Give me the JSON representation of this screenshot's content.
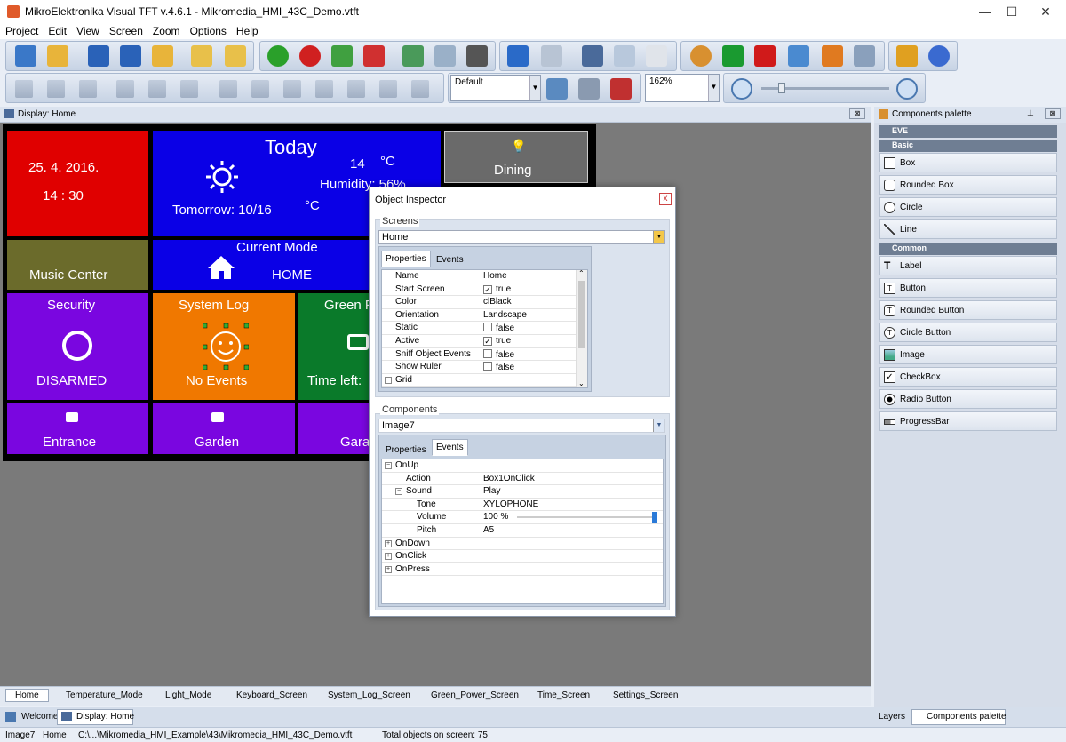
{
  "window": {
    "title": "MikroElektronika Visual TFT v.4.6.1 - Mikromedia_HMI_43C_Demo.vtft",
    "min": "—",
    "max": "☐",
    "close": "✕"
  },
  "menu": [
    "Project",
    "Edit",
    "View",
    "Screen",
    "Zoom",
    "Options",
    "Help"
  ],
  "toolbar": {
    "style_combo": "Default",
    "zoom_combo": "162%",
    "zoom_level": 0.14
  },
  "display_panel": {
    "title": "Display: Home"
  },
  "hmi": {
    "date": "25.    4.    2016.",
    "time": "14    :    30",
    "today": "Today",
    "temp": "14",
    "deg_c": "°C",
    "humidity": "Humidity: 56%",
    "tomorrow": "Tomorrow: 10/16",
    "tomorrow_deg": "°C",
    "dining": "Dining",
    "music": "Music Center",
    "current_mode": "Current Mode",
    "home": "HOME",
    "security": "Security",
    "disarmed": "DISARMED",
    "system_log": "System Log",
    "no_events": "No Events",
    "green": "Green P",
    "time_left": "Time left:",
    "entrance": "Entrance",
    "garden": "Garden",
    "garage": "Gara"
  },
  "colors": {
    "red": "#e00000",
    "blue": "#0a00e6",
    "gray": "#6a6a6a",
    "olive": "#6b6b2b",
    "purple": "#7a06e0",
    "orange": "#f07800",
    "green": "#0a7a2a"
  },
  "screen_tabs": [
    "Home",
    "Temperature_Mode",
    "Light_Mode",
    "Keyboard_Screen",
    "System_Log_Screen",
    "Green_Power_Screen",
    "Time_Screen",
    "Settings_Screen"
  ],
  "doc_tabs": [
    "Welcome",
    "Display: Home"
  ],
  "right_tabs": [
    "Layers",
    "Components palette"
  ],
  "status": {
    "obj": "Image7",
    "screen": "Home",
    "path": "C:\\...\\Mikromedia_HMI_Example\\43\\Mikromedia_HMI_43C_Demo.vtft",
    "total": "Total objects on screen: 75"
  },
  "palette": {
    "title": "Components palette",
    "groups": {
      "eve": "EVE",
      "basic": "Basic",
      "common": "Common"
    },
    "basic": [
      "Box",
      "Rounded Box",
      "Circle",
      "Line"
    ],
    "common": [
      "Label",
      "Button",
      "Rounded Button",
      "Circle Button",
      "Image",
      "CheckBox",
      "Radio Button",
      "ProgressBar"
    ]
  },
  "inspector": {
    "title": "Object Inspector",
    "close": "x",
    "screens_label": "Screens",
    "screen_value": "Home",
    "tabs": [
      "Properties",
      "Events"
    ],
    "properties": [
      {
        "k": "Name",
        "v": "Home"
      },
      {
        "k": "Start Screen",
        "v": "true",
        "check": "✓"
      },
      {
        "k": "Color",
        "v": "clBlack"
      },
      {
        "k": "Orientation",
        "v": "Landscape"
      },
      {
        "k": "Static",
        "v": "false",
        "check": ""
      },
      {
        "k": "Active",
        "v": "true",
        "check": "✓"
      },
      {
        "k": "Sniff Object Events",
        "v": "false",
        "check": ""
      },
      {
        "k": "Show Ruler",
        "v": "false",
        "check": ""
      },
      {
        "k": "Grid",
        "v": ""
      }
    ],
    "components_label": "Components",
    "component_value": "Image7",
    "events": [
      {
        "k": "OnUp",
        "v": ""
      },
      {
        "k": "Action",
        "v": "Box1OnClick"
      },
      {
        "k": "Sound",
        "v": "Play"
      },
      {
        "k": "Tone",
        "v": "XYLOPHONE"
      },
      {
        "k": "Volume",
        "v": "100 %"
      },
      {
        "k": "Pitch",
        "v": "A5"
      },
      {
        "k": "OnDown",
        "v": ""
      },
      {
        "k": "OnClick",
        "v": ""
      },
      {
        "k": "OnPress",
        "v": ""
      }
    ],
    "volume_level": 1.0
  }
}
